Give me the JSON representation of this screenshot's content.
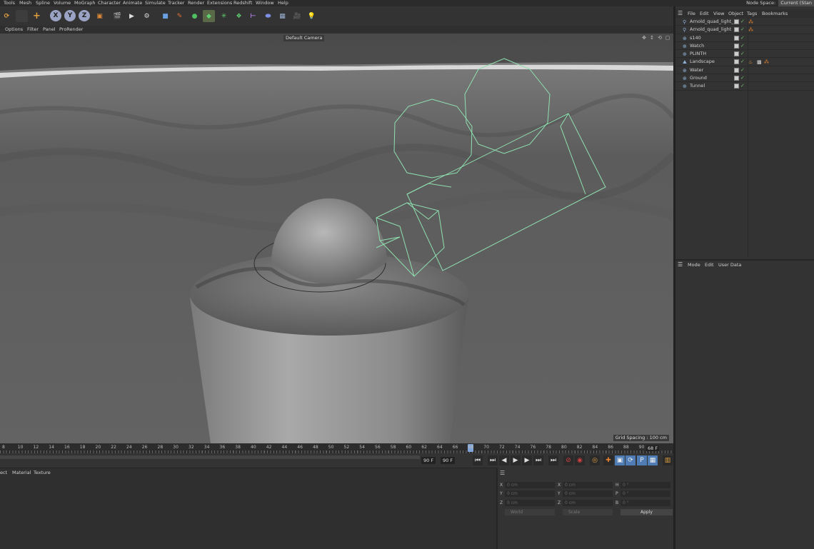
{
  "menubar": {
    "items": [
      "Tools",
      "Mesh",
      "Spline",
      "Volume",
      "MoGraph",
      "Character",
      "Animate",
      "Simulate",
      "Tracker",
      "Render",
      "Extensions",
      "Redshift",
      "Window",
      "Help"
    ],
    "node_space_label": "Node Space:",
    "node_space_value": "Current (Stan"
  },
  "toolbar": {
    "axis_x": "X",
    "axis_y": "Y",
    "axis_z": "Z"
  },
  "viewport_menu": {
    "items": [
      "Options",
      "Filter",
      "Panel",
      "ProRender"
    ]
  },
  "viewport": {
    "camera_label": "Default Camera",
    "grid_spacing": "Grid Spacing : 100 cm"
  },
  "object_manager": {
    "menu": [
      "File",
      "Edit",
      "View",
      "Object",
      "Tags",
      "Bookmarks"
    ],
    "objects": [
      {
        "name": "Arnold_quad_light_1",
        "icon": "light-icon"
      },
      {
        "name": "Arnold_quad_light",
        "icon": "light-icon"
      },
      {
        "name": "s140",
        "icon": "null-icon"
      },
      {
        "name": "Watch",
        "icon": "null-icon"
      },
      {
        "name": "PLINTH",
        "icon": "null-icon"
      },
      {
        "name": "Landscape",
        "icon": "landscape-icon"
      },
      {
        "name": "Water",
        "icon": "null-icon"
      },
      {
        "name": "Ground",
        "icon": "null-icon"
      },
      {
        "name": "Tunnel",
        "icon": "null-icon"
      }
    ]
  },
  "attribute_manager": {
    "menu": [
      "Mode",
      "Edit",
      "User Data"
    ]
  },
  "timeline": {
    "ticks": [
      "8",
      "10",
      "12",
      "14",
      "16",
      "18",
      "20",
      "22",
      "24",
      "26",
      "28",
      "30",
      "32",
      "34",
      "36",
      "38",
      "40",
      "42",
      "44",
      "46",
      "48",
      "50",
      "52",
      "54",
      "56",
      "58",
      "60",
      "62",
      "64",
      "66",
      "68",
      "70",
      "72",
      "74",
      "76",
      "78",
      "80",
      "82",
      "84",
      "86",
      "88",
      "90"
    ],
    "current_frame": "68 F",
    "current_tick": "68"
  },
  "transport": {
    "end_frame_a": "90 F",
    "end_frame_b": "90 F"
  },
  "material_manager": {
    "menu": [
      "ect",
      "Material",
      "Texture"
    ]
  },
  "coordinates": {
    "pos_x_label": "X",
    "pos_y_label": "Y",
    "pos_z_label": "Z",
    "size_x_label": "X",
    "size_y_label": "Y",
    "size_z_label": "Z",
    "rot_h_label": "H",
    "rot_p_label": "P",
    "rot_b_label": "B",
    "pos_x": "0 cm",
    "pos_y": "0 cm",
    "pos_z": "0 cm",
    "size_x": "0 cm",
    "size_y": "0 cm",
    "size_z": "0 cm",
    "rot_h": "0 °",
    "rot_p": "0 °",
    "rot_b": "0 °",
    "mode_world": "World",
    "mode_scale": "Scale",
    "apply": "Apply"
  },
  "colors": {
    "wireframe": "#8fe0b0",
    "accent_blue": "#7fa5d8",
    "checkmark_green": "#6fbf6f"
  }
}
